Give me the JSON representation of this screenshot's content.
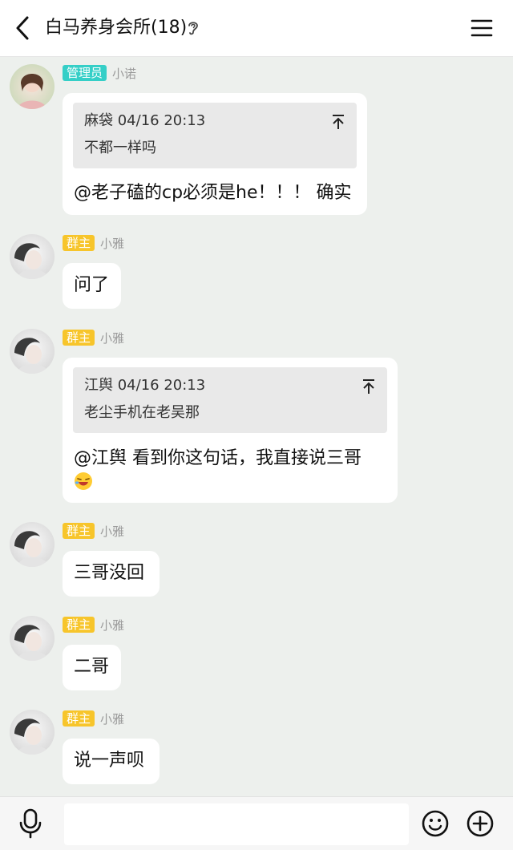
{
  "header": {
    "title": "白马养身会所(18)",
    "back_icon": "back-chevron-icon",
    "ear_icon": "ear-icon",
    "menu_icon": "menu-icon"
  },
  "colors": {
    "background": "#edf0ed",
    "admin_badge": "#35cfc7",
    "owner_badge": "#f7c52b"
  },
  "messages": [
    {
      "role": "管理员",
      "nickname": "小诺",
      "quote": {
        "sender": "麻袋",
        "time": "04/16 20:13",
        "text": "不都一样吗"
      },
      "text": "@老子磕的cp必须是he！！！ 确实"
    },
    {
      "role": "群主",
      "nickname": "小雅",
      "text": "问了"
    },
    {
      "role": "群主",
      "nickname": "小雅",
      "quote": {
        "sender": "江舆",
        "time": "04/16 20:13",
        "text": "老尘手机在老吴那"
      },
      "text": "@江舆 看到你这句话，我直接说三哥",
      "emoji": "laughing-emoji"
    },
    {
      "role": "群主",
      "nickname": "小雅",
      "text": "三哥没回"
    },
    {
      "role": "群主",
      "nickname": "小雅",
      "text": "二哥"
    },
    {
      "role": "群主",
      "nickname": "小雅",
      "text": "说一声呗"
    }
  ],
  "bottombar": {
    "input_value": "",
    "mic_icon": "microphone-icon",
    "emoji_icon": "smiley-icon",
    "plus_icon": "plus-circle-icon"
  }
}
